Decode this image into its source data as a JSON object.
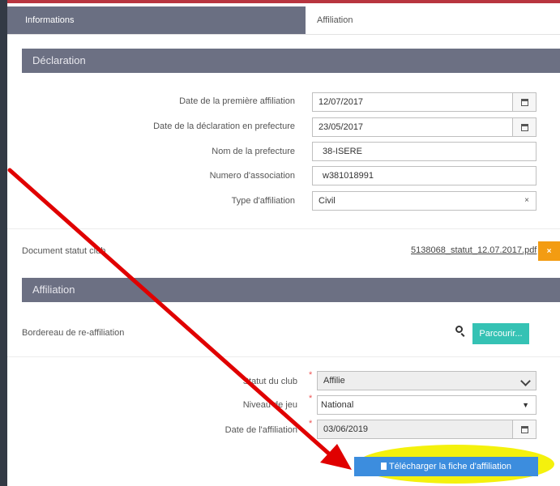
{
  "tabs": {
    "informations": "Informations",
    "affiliation": "Affiliation"
  },
  "declaration": {
    "title": "Déclaration",
    "fields": [
      {
        "label": "Date de la première affiliation",
        "value": "12/07/2017",
        "icon": "calendar-icon"
      },
      {
        "label": "Date de la déclaration en prefecture",
        "value": "23/05/2017",
        "icon": "calendar-icon"
      },
      {
        "label": "Nom de la prefecture",
        "value": "38-ISERE"
      },
      {
        "label": "Numero d'association",
        "value": "w381018991"
      },
      {
        "label": "Type d'affiliation",
        "value": "Civil",
        "clear": "×"
      }
    ]
  },
  "document": {
    "label": "Document statut club",
    "file": "5138068_statut_12.07.2017.pdf",
    "remove": "×"
  },
  "affiliation": {
    "title": "Affiliation",
    "bordereau_label": "Bordereau de re-affiliation",
    "browse": "Parcourir...",
    "statut": {
      "label": "Statut du club",
      "value": "Affilie"
    },
    "niveau": {
      "label": "Niveau de jeu",
      "value": "National"
    },
    "date": {
      "label": "Date de l'affiliation",
      "value": "03/06/2019"
    },
    "required": "*",
    "download": "Télécharger la fiche d'affiliation"
  },
  "colors": {
    "arrow": "#e00000",
    "highlight": "#f3f000",
    "section": "#6c7083",
    "orange": "#f39c12",
    "teal": "#35c2b4",
    "blue": "#3c8dde"
  }
}
